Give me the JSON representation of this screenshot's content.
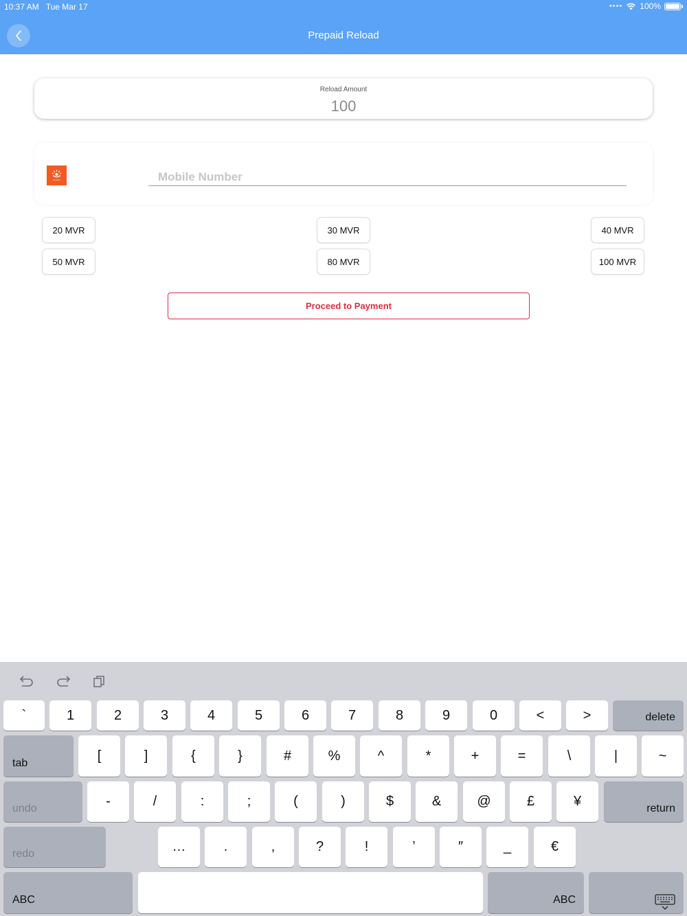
{
  "status_bar": {
    "time": "10:37 AM",
    "date": "Tue Mar 17",
    "battery": "100%"
  },
  "nav": {
    "title": "Prepaid Reload",
    "back_icon": "chevron-left-icon"
  },
  "reload_amount": {
    "label": "Reload Amount",
    "value": "100"
  },
  "mobile": {
    "placeholder": "Mobile Number",
    "operator_logo": "operator-logo",
    "operator_logo_text": "Ooredoo"
  },
  "amount_options": [
    "20 MVR",
    "30 MVR",
    "40 MVR",
    "50 MVR",
    "80 MVR",
    "100 MVR"
  ],
  "proceed_label": "Proceed to Payment",
  "colors": {
    "nav_bar": "#5aa3f6",
    "accent_red": "#e32a43",
    "operator_orange": "#f15a22",
    "keyboard_bg": "#d1d3d9"
  },
  "keyboard": {
    "toolbar": [
      "undo-icon",
      "redo-icon",
      "paste-icon"
    ],
    "row1": [
      "`",
      "1",
      "2",
      "3",
      "4",
      "5",
      "6",
      "7",
      "8",
      "9",
      "0",
      "<",
      ">"
    ],
    "delete": "delete",
    "tab": "tab",
    "row2": [
      "[",
      "]",
      "{",
      "}",
      "#",
      "%",
      "^",
      "*",
      "+",
      "=",
      "\\",
      "|",
      "~"
    ],
    "undo": "undo",
    "row3": [
      "-",
      "/",
      ":",
      ";",
      "(",
      ")",
      "$",
      "&",
      "@",
      "£",
      "¥"
    ],
    "return": "return",
    "redo": "redo",
    "row4": [
      "…",
      ".",
      ",",
      "?",
      "!",
      "’",
      "″",
      "_",
      "€"
    ],
    "abc_left": "ABC",
    "abc_right": "ABC",
    "dismiss_icon": "keyboard-dismiss-icon"
  }
}
